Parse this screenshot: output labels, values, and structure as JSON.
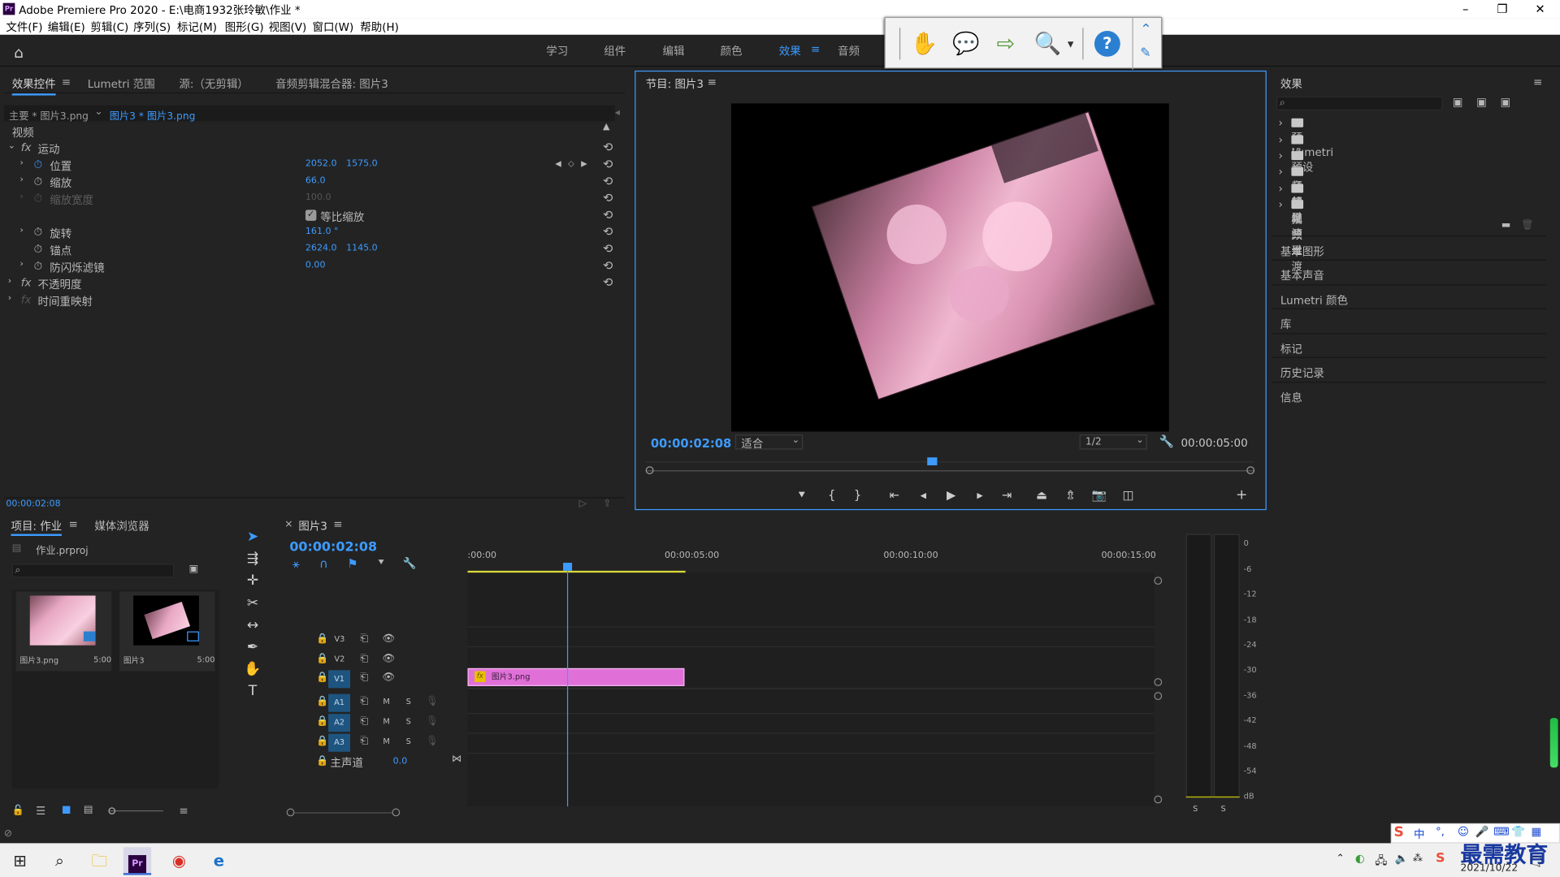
{
  "window": {
    "title": "Adobe Premiere Pro 2020 - E:\\电商1932张玲敏\\作业 *",
    "app_badge": "Pr",
    "controls": {
      "minimize": "–",
      "maximize": "❐",
      "close": "✕"
    }
  },
  "menu": [
    "文件(F)",
    "编辑(E)",
    "剪辑(C)",
    "序列(S)",
    "标记(M)",
    "图形(G)",
    "视图(V)",
    "窗口(W)",
    "帮助(H)"
  ],
  "workspaces": {
    "items": [
      "学习",
      "组件",
      "编辑",
      "颜色",
      "效果",
      "音频"
    ],
    "active": "效果",
    "menu_icon": "≡"
  },
  "float_toolbar": {
    "icons": [
      "hand-icon",
      "comment-icon",
      "export-icon",
      "zoom-icon",
      "help-icon",
      "collapse-icon",
      "pin-icon"
    ]
  },
  "effect_controls": {
    "tabs": [
      "效果控件",
      "Lumetri 范围",
      "源:（无剪辑）",
      "音频剪辑混合器: 图片3"
    ],
    "tab_menu": "≡",
    "master_clip": "主要 * 图片3.png",
    "sequence_clip": "图片3 * 图片3.png",
    "video_header": "视频",
    "fx_badge": "fx",
    "motion": {
      "label": "运动",
      "properties": [
        {
          "name": "位置",
          "values": [
            "2052.0",
            "1575.0"
          ]
        },
        {
          "name": "缩放",
          "values": [
            "66.0"
          ]
        },
        {
          "name": "缩放宽度",
          "values": [
            "100.0"
          ],
          "disabled": true
        },
        {
          "name": "等比缩放",
          "checkbox": true,
          "checked": true
        },
        {
          "name": "旋转",
          "values": [
            "161.0 °"
          ]
        },
        {
          "name": "锚点",
          "values": [
            "2624.0",
            "1145.0"
          ]
        },
        {
          "name": "防闪烁滤镜",
          "values": [
            "0.00"
          ]
        }
      ]
    },
    "opacity": "不透明度",
    "time_remap": "时间重映射",
    "timecode": "00:00:02:08"
  },
  "program_monitor": {
    "title": "节目: 图片3",
    "timecode": "00:00:02:08",
    "fit": "适合",
    "resolution": "1/2",
    "duration": "00:00:05:00",
    "playhead_fraction": 0.47
  },
  "effects_panel": {
    "title": "效果",
    "menu_icon": "≡",
    "search_placeholder": "",
    "folders": [
      "预设",
      "Lumetri 预设",
      "音频效果",
      "音频过渡",
      "视频效果",
      "视频过渡"
    ],
    "sections": [
      "基本图形",
      "基本声音",
      "Lumetri 颜色",
      "库",
      "标记",
      "历史记录",
      "信息"
    ]
  },
  "project_panel": {
    "tabs": [
      "项目: 作业",
      "媒体浏览器"
    ],
    "tab_menu": "≡",
    "project_file": "作业.prproj",
    "items": [
      {
        "name": "图片3.png",
        "duration": "5:00"
      },
      {
        "name": "图片3",
        "duration": "5:00"
      }
    ]
  },
  "timeline": {
    "sequence_tab": "图片3",
    "close_icon": "×",
    "menu_icon": "≡",
    "timecode": "00:00:02:08",
    "ruler": [
      ":00:00",
      "00:00:05:00",
      "00:00:10:00",
      "00:00:15:00"
    ],
    "video_tracks": [
      "V3",
      "V2",
      "V1"
    ],
    "audio_tracks": [
      "A1",
      "A2",
      "A3"
    ],
    "audio_buttons": [
      "M",
      "S"
    ],
    "master": {
      "label": "主声道",
      "value": "0.0"
    },
    "clip": {
      "name": "图片3.png",
      "fx": "fx"
    }
  },
  "audio_meter": {
    "scale": [
      "0",
      "-6",
      "-12",
      "-18",
      "-24",
      "-30",
      "-36",
      "-42",
      "-48",
      "-54",
      "dB"
    ],
    "solo": [
      "S",
      "S"
    ]
  },
  "taskbar": {
    "time": "",
    "date": "2021/10/22",
    "watermark": "最需教育",
    "ime": "中",
    "apps": [
      "start-icon",
      "search-icon",
      "explorer-icon",
      "premiere-icon",
      "chrome-icon",
      "edge-icon"
    ]
  },
  "colors": {
    "accent": "#3d9bff",
    "clip": "#e070d8",
    "panel": "#232323"
  }
}
